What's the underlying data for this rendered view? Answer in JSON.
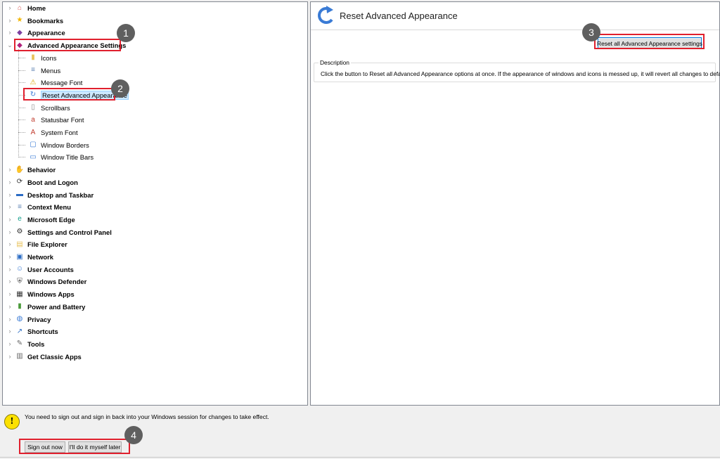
{
  "tree": {
    "items": [
      {
        "label": "Home",
        "icon": "home-icon",
        "glyph": "⌂",
        "color": "#d9534f",
        "expanded": false
      },
      {
        "label": "Bookmarks",
        "icon": "star-icon",
        "glyph": "★",
        "color": "#f2b600",
        "expanded": false
      },
      {
        "label": "Appearance",
        "icon": "palette-icon",
        "glyph": "◆",
        "color": "#7b3fa0",
        "expanded": false
      },
      {
        "label": "Advanced Appearance Settings",
        "icon": "palette-advanced-icon",
        "glyph": "◆",
        "color": "#b0207a",
        "expanded": true,
        "children": [
          {
            "label": "Icons",
            "icon": "folder-icon",
            "glyph": "▮",
            "color": "#e8c25a"
          },
          {
            "label": "Menus",
            "icon": "menu-icon",
            "glyph": "≡",
            "color": "#5a7fb0"
          },
          {
            "label": "Message Font",
            "icon": "warning-icon",
            "glyph": "⚠",
            "color": "#d9a400"
          },
          {
            "label": "Reset Advanced Appearance",
            "icon": "reset-icon",
            "glyph": "↻",
            "color": "#3a7bd5",
            "selected": true
          },
          {
            "label": "Scrollbars",
            "icon": "scrollbar-icon",
            "glyph": "▯",
            "color": "#8a8a8a"
          },
          {
            "label": "Statusbar Font",
            "icon": "font-file-icon",
            "glyph": "a",
            "color": "#c0392b"
          },
          {
            "label": "System Font",
            "icon": "system-font-icon",
            "glyph": "A",
            "color": "#c0392b"
          },
          {
            "label": "Window Borders",
            "icon": "window-border-icon",
            "glyph": "▢",
            "color": "#3a7bd5"
          },
          {
            "label": "Window Title Bars",
            "icon": "title-bar-icon",
            "glyph": "▭",
            "color": "#3a7bd5"
          }
        ]
      },
      {
        "label": "Behavior",
        "icon": "behavior-icon",
        "glyph": "✋",
        "color": "#c9a25a",
        "expanded": false
      },
      {
        "label": "Boot and Logon",
        "icon": "boot-icon",
        "glyph": "⟳",
        "color": "#333333",
        "expanded": false
      },
      {
        "label": "Desktop and Taskbar",
        "icon": "desktop-icon",
        "glyph": "▬",
        "color": "#2b6cc4",
        "expanded": false
      },
      {
        "label": "Context Menu",
        "icon": "context-menu-icon",
        "glyph": "≡",
        "color": "#5a7fb0",
        "expanded": false
      },
      {
        "label": "Microsoft Edge",
        "icon": "edge-icon",
        "glyph": "e",
        "color": "#0f9d8a",
        "expanded": false
      },
      {
        "label": "Settings and Control Panel",
        "icon": "gear-icon",
        "glyph": "⚙",
        "color": "#333333",
        "expanded": false
      },
      {
        "label": "File Explorer",
        "icon": "explorer-icon",
        "glyph": "▤",
        "color": "#e8c25a",
        "expanded": false
      },
      {
        "label": "Network",
        "icon": "network-icon",
        "glyph": "▣",
        "color": "#2b6cc4",
        "expanded": false
      },
      {
        "label": "User Accounts",
        "icon": "user-icon",
        "glyph": "☺",
        "color": "#3a7bd5",
        "expanded": false
      },
      {
        "label": "Windows Defender",
        "icon": "defender-icon",
        "glyph": "⛨",
        "color": "#444444",
        "expanded": false
      },
      {
        "label": "Windows Apps",
        "icon": "apps-icon",
        "glyph": "▦",
        "color": "#333333",
        "expanded": false
      },
      {
        "label": "Power and Battery",
        "icon": "battery-icon",
        "glyph": "▮",
        "color": "#4a9a3a",
        "expanded": false
      },
      {
        "label": "Privacy",
        "icon": "privacy-icon",
        "glyph": "◍",
        "color": "#3a7bd5",
        "expanded": false
      },
      {
        "label": "Shortcuts",
        "icon": "shortcut-icon",
        "glyph": "↗",
        "color": "#2b6cc4",
        "expanded": false
      },
      {
        "label": "Tools",
        "icon": "tools-icon",
        "glyph": "✎",
        "color": "#666666",
        "expanded": false
      },
      {
        "label": "Get Classic Apps",
        "icon": "classic-apps-icon",
        "glyph": "▥",
        "color": "#666666",
        "expanded": false
      }
    ]
  },
  "right": {
    "title": "Reset Advanced Appearance",
    "reset_button": "Reset all Advanced Appearance settings",
    "description_label": "Description",
    "description_text": "Click the button to Reset all Advanced Appearance options at once. If the appearance of windows and icons is messed up, it will revert all changes to defaults."
  },
  "bottom": {
    "info_text": "You need to sign out and sign in back into your Windows session for changes to take effect.",
    "sign_out_button": "Sign out now",
    "later_button": "I'll do it myself later"
  },
  "callouts": [
    "1",
    "2",
    "3",
    "4"
  ],
  "colors": {
    "highlight": "#e0202e",
    "badge": "#5f5f5f",
    "selection": "#cce8ff"
  }
}
